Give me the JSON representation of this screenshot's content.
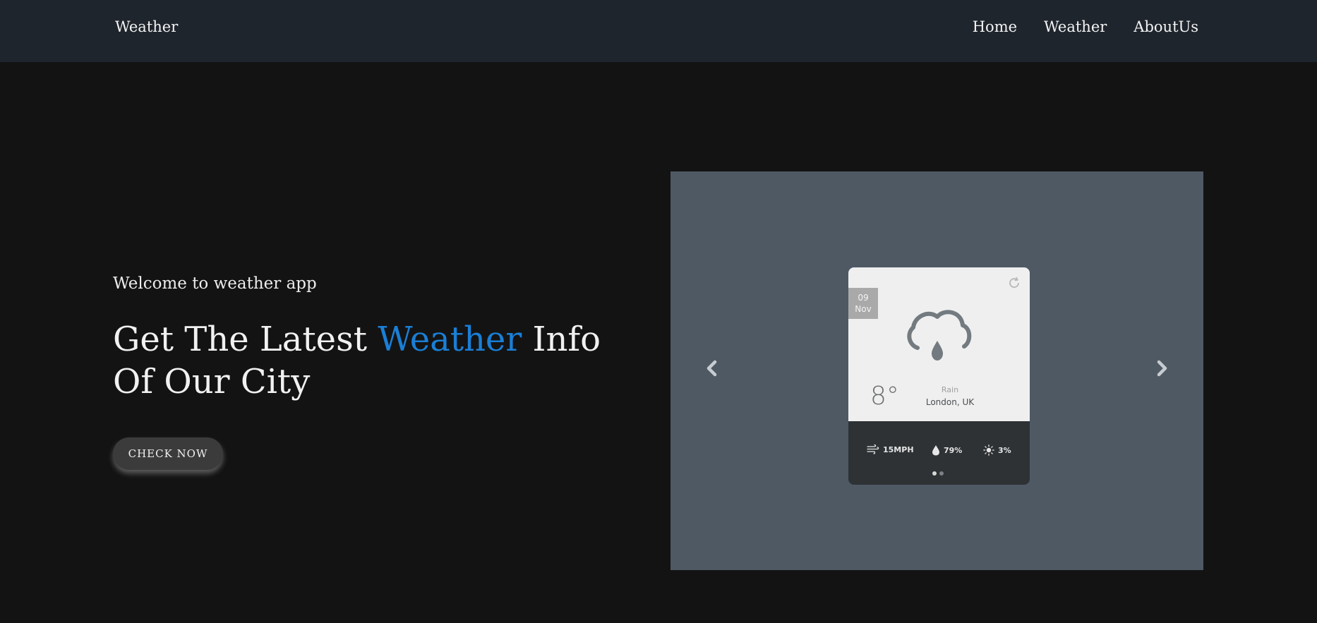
{
  "nav": {
    "brand": "Weather",
    "links": [
      "Home",
      "Weather",
      "AboutUs"
    ]
  },
  "hero": {
    "welcome": "Welcome to weather app",
    "headline_before": "Get The Latest",
    "headline_accent": "Weather",
    "headline_after": "Info Of Our City",
    "cta_label": "CHECK NOW"
  },
  "widget": {
    "date_day": "09",
    "date_month": "Nov",
    "temperature": "8°",
    "condition": "Rain",
    "location": "London, UK",
    "wind": "15MPH",
    "humidity": "79%",
    "uv": "3%",
    "icons": [
      "refresh-icon",
      "rain-cloud-icon",
      "wind-icon",
      "droplet-icon",
      "sun-icon"
    ]
  },
  "carousel": {
    "slide_count": 2,
    "active_index": 0,
    "icons": [
      "chevron-left-icon",
      "chevron-right-icon"
    ]
  },
  "colors": {
    "navbar_bg": "#1f252d",
    "page_bg": "#131313",
    "accent": "#1a7fd6",
    "carousel_bg": "#4e5964",
    "widget_top": "#efefef",
    "widget_bottom": "#2e3235"
  }
}
